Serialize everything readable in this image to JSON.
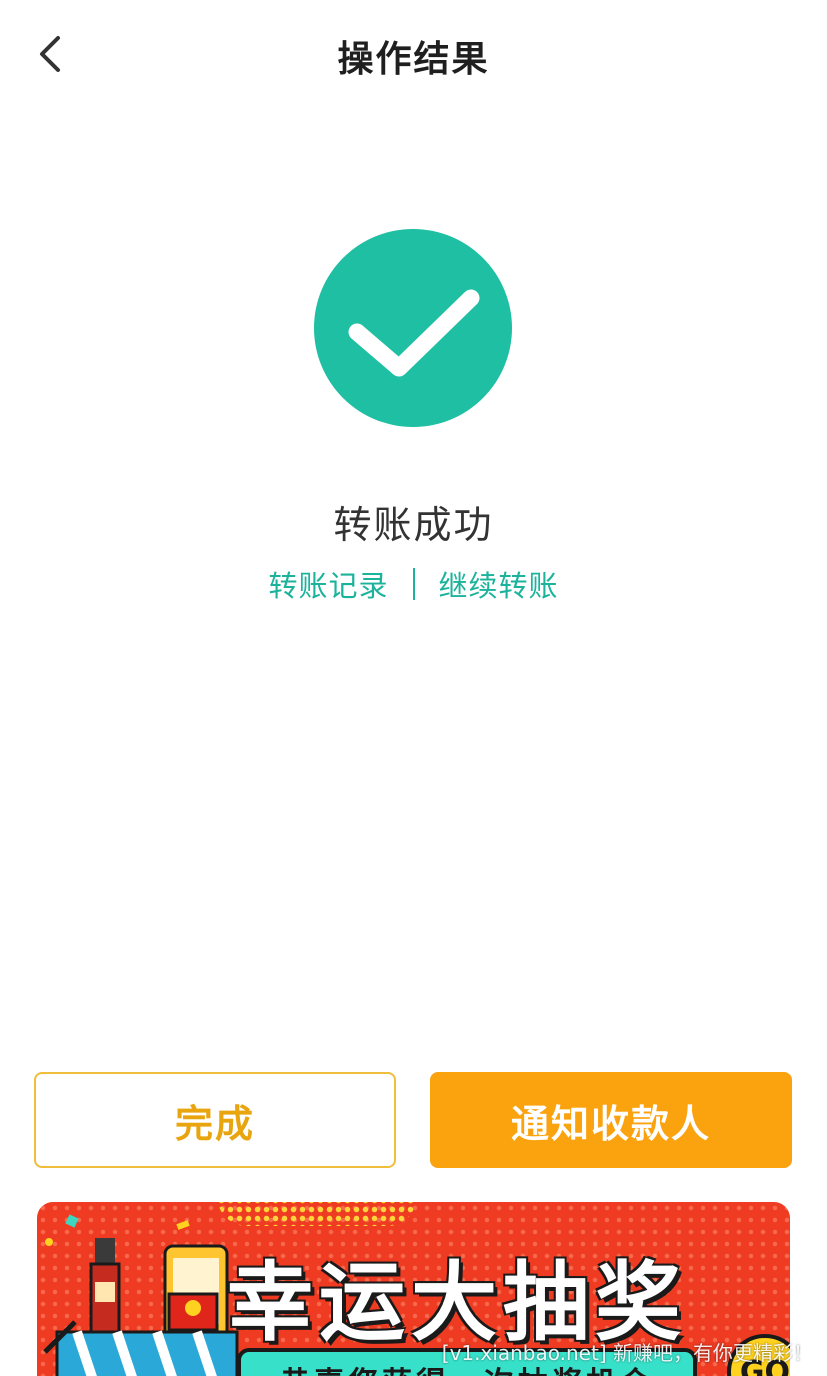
{
  "nav": {
    "title": "操作结果"
  },
  "result": {
    "title": "转账成功"
  },
  "links": {
    "records": "转账记录",
    "separator": "|",
    "continue": "继续转账"
  },
  "buttons": {
    "done": "完成",
    "notify": "通知收款人"
  },
  "banner": {
    "title": "幸运大抽奖",
    "subtitle": "恭喜您获得一次抽奖机会",
    "go": "GO"
  },
  "watermark": "[v1.xianbao.net] 新赚吧，有你更精彩！",
  "colors": {
    "accent_teal": "#1bb39c",
    "success_circle": "#1ebfa3",
    "orange": "#fba20f",
    "outline_gold": "#f1bd3c",
    "banner_red": "#ef3b22"
  },
  "icons": {
    "back": "chevron-left-icon",
    "success": "check-circle-icon"
  }
}
